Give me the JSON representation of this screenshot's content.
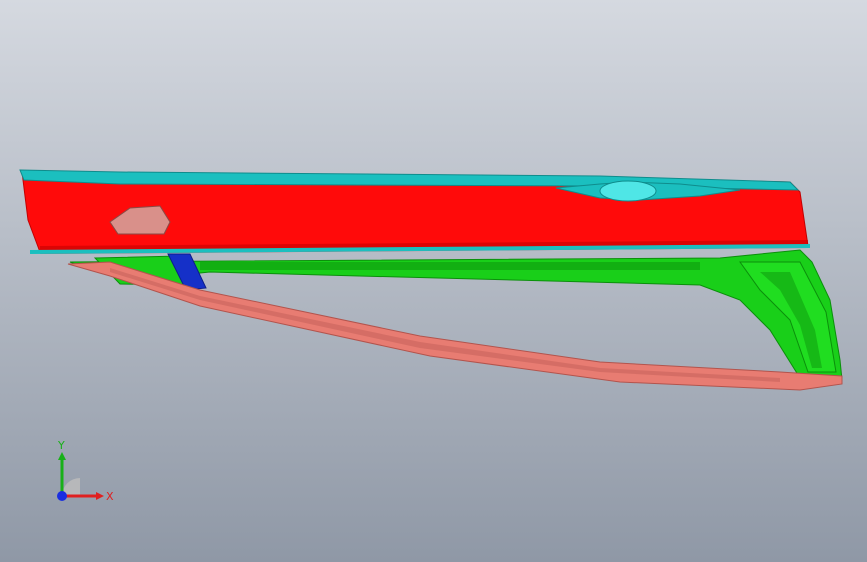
{
  "viewport": {
    "background_top": "#d5d9e0",
    "background_bottom": "#8f98a6"
  },
  "model": {
    "colors": {
      "panel_red": "#ff0a0a",
      "panel_red_dark": "#c40000",
      "top_cyan": "#1bbfbf",
      "top_cyan_light": "#4fe6e6",
      "frame_green": "#19cf19",
      "frame_green_dark": "#0b8f0b",
      "sill_salmon": "#e87c72",
      "sill_salmon_dark": "#b2544d",
      "bracket_blue": "#1530c8",
      "handle_pink": "#d9908a"
    }
  },
  "triad": {
    "x_label": "X",
    "y_label": "Y",
    "x_color": "#e02020",
    "y_color": "#18b018",
    "z_color": "#1a2ee0"
  }
}
